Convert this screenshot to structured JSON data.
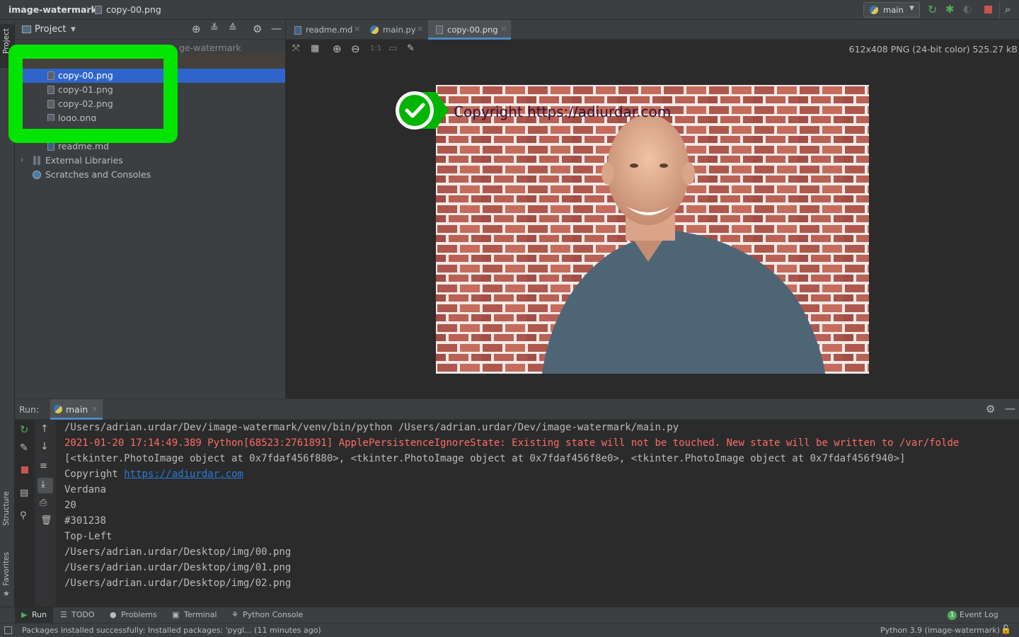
{
  "titlebar": {
    "project": "image-watermark",
    "file": "copy-00.png",
    "run_config": "main"
  },
  "left_strip": {
    "project_label": "Project",
    "structure_label": "Structure",
    "favorites_label": "Favorites"
  },
  "project_panel": {
    "title": "Project",
    "root_partial": "ge-watermark",
    "files": [
      "copy-00.png",
      "copy-01.png",
      "copy-02.png",
      "logo.png",
      "readme.md"
    ],
    "external_libraries": "External Libraries",
    "scratches": "Scratches and Consoles"
  },
  "editor": {
    "tabs": [
      {
        "label": "readme.md",
        "active": false
      },
      {
        "label": "main.py",
        "active": false
      },
      {
        "label": "copy-00.png",
        "active": true
      }
    ],
    "zoom_label": "1:1",
    "image_info": "612x408 PNG (24-bit color) 525.27 kB",
    "watermark_text": "Copyright https://adiurdar.com"
  },
  "run": {
    "label": "Run:",
    "tab": "main",
    "lines": [
      {
        "text": "/Users/adrian.urdar/Dev/image-watermark/venv/bin/python /Users/adrian.urdar/Dev/image-watermark/main.py",
        "type": "normal"
      },
      {
        "text": "2021-01-20 17:14:49.389 Python[68523:2761891] ApplePersistenceIgnoreState: Existing state will not be touched. New state will be written to /var/folde",
        "type": "error"
      },
      {
        "text": "[<tkinter.PhotoImage object at 0x7fdaf456f880>, <tkinter.PhotoImage object at 0x7fdaf456f8e0>, <tkinter.PhotoImage object at 0x7fdaf456f940>]",
        "type": "normal"
      },
      {
        "text": "Copyright ",
        "link": "https://adiurdar.com",
        "type": "link"
      },
      {
        "text": "Verdana",
        "type": "normal"
      },
      {
        "text": "20",
        "type": "normal"
      },
      {
        "text": "#301238",
        "type": "normal"
      },
      {
        "text": "Top-Left",
        "type": "normal"
      },
      {
        "text": "/Users/adrian.urdar/Desktop/img/00.png",
        "type": "normal"
      },
      {
        "text": "/Users/adrian.urdar/Desktop/img/01.png",
        "type": "normal"
      },
      {
        "text": "/Users/adrian.urdar/Desktop/img/02.png",
        "type": "normal"
      }
    ]
  },
  "bottom_tabs": {
    "run": "Run",
    "todo": "TODO",
    "problems": "Problems",
    "terminal": "Terminal",
    "python_console": "Python Console",
    "event_log": "Event Log",
    "event_count": "1"
  },
  "status": {
    "message": "Packages installed successfully: Installed packages: 'pygl... (11 minutes ago)",
    "interpreter": "Python 3.9 (image-watermark)"
  },
  "colors": {
    "highlight": "#00e400",
    "selection": "#2f65ca",
    "error_text": "#ff6b68",
    "link": "#287bde",
    "run_green": "#4fab5b",
    "stop_red": "#c75450"
  }
}
